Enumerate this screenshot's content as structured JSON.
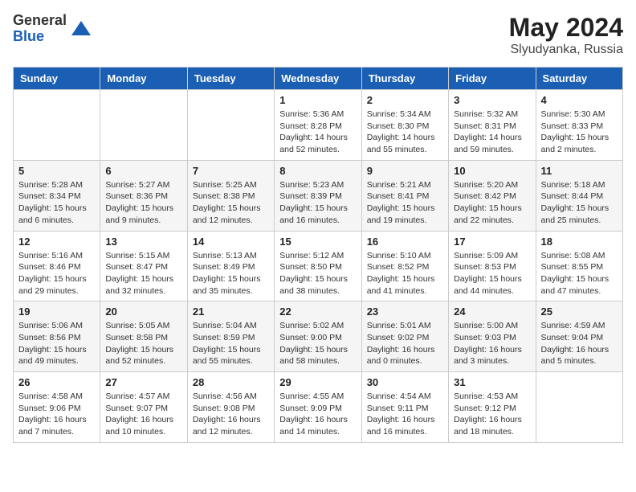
{
  "header": {
    "logo_general": "General",
    "logo_blue": "Blue",
    "month": "May 2024",
    "location": "Slyudyanka, Russia"
  },
  "weekdays": [
    "Sunday",
    "Monday",
    "Tuesday",
    "Wednesday",
    "Thursday",
    "Friday",
    "Saturday"
  ],
  "weeks": [
    [
      {
        "day": "",
        "info": ""
      },
      {
        "day": "",
        "info": ""
      },
      {
        "day": "",
        "info": ""
      },
      {
        "day": "1",
        "info": "Sunrise: 5:36 AM\nSunset: 8:28 PM\nDaylight: 14 hours\nand 52 minutes."
      },
      {
        "day": "2",
        "info": "Sunrise: 5:34 AM\nSunset: 8:30 PM\nDaylight: 14 hours\nand 55 minutes."
      },
      {
        "day": "3",
        "info": "Sunrise: 5:32 AM\nSunset: 8:31 PM\nDaylight: 14 hours\nand 59 minutes."
      },
      {
        "day": "4",
        "info": "Sunrise: 5:30 AM\nSunset: 8:33 PM\nDaylight: 15 hours\nand 2 minutes."
      }
    ],
    [
      {
        "day": "5",
        "info": "Sunrise: 5:28 AM\nSunset: 8:34 PM\nDaylight: 15 hours\nand 6 minutes."
      },
      {
        "day": "6",
        "info": "Sunrise: 5:27 AM\nSunset: 8:36 PM\nDaylight: 15 hours\nand 9 minutes."
      },
      {
        "day": "7",
        "info": "Sunrise: 5:25 AM\nSunset: 8:38 PM\nDaylight: 15 hours\nand 12 minutes."
      },
      {
        "day": "8",
        "info": "Sunrise: 5:23 AM\nSunset: 8:39 PM\nDaylight: 15 hours\nand 16 minutes."
      },
      {
        "day": "9",
        "info": "Sunrise: 5:21 AM\nSunset: 8:41 PM\nDaylight: 15 hours\nand 19 minutes."
      },
      {
        "day": "10",
        "info": "Sunrise: 5:20 AM\nSunset: 8:42 PM\nDaylight: 15 hours\nand 22 minutes."
      },
      {
        "day": "11",
        "info": "Sunrise: 5:18 AM\nSunset: 8:44 PM\nDaylight: 15 hours\nand 25 minutes."
      }
    ],
    [
      {
        "day": "12",
        "info": "Sunrise: 5:16 AM\nSunset: 8:46 PM\nDaylight: 15 hours\nand 29 minutes."
      },
      {
        "day": "13",
        "info": "Sunrise: 5:15 AM\nSunset: 8:47 PM\nDaylight: 15 hours\nand 32 minutes."
      },
      {
        "day": "14",
        "info": "Sunrise: 5:13 AM\nSunset: 8:49 PM\nDaylight: 15 hours\nand 35 minutes."
      },
      {
        "day": "15",
        "info": "Sunrise: 5:12 AM\nSunset: 8:50 PM\nDaylight: 15 hours\nand 38 minutes."
      },
      {
        "day": "16",
        "info": "Sunrise: 5:10 AM\nSunset: 8:52 PM\nDaylight: 15 hours\nand 41 minutes."
      },
      {
        "day": "17",
        "info": "Sunrise: 5:09 AM\nSunset: 8:53 PM\nDaylight: 15 hours\nand 44 minutes."
      },
      {
        "day": "18",
        "info": "Sunrise: 5:08 AM\nSunset: 8:55 PM\nDaylight: 15 hours\nand 47 minutes."
      }
    ],
    [
      {
        "day": "19",
        "info": "Sunrise: 5:06 AM\nSunset: 8:56 PM\nDaylight: 15 hours\nand 49 minutes."
      },
      {
        "day": "20",
        "info": "Sunrise: 5:05 AM\nSunset: 8:58 PM\nDaylight: 15 hours\nand 52 minutes."
      },
      {
        "day": "21",
        "info": "Sunrise: 5:04 AM\nSunset: 8:59 PM\nDaylight: 15 hours\nand 55 minutes."
      },
      {
        "day": "22",
        "info": "Sunrise: 5:02 AM\nSunset: 9:00 PM\nDaylight: 15 hours\nand 58 minutes."
      },
      {
        "day": "23",
        "info": "Sunrise: 5:01 AM\nSunset: 9:02 PM\nDaylight: 16 hours\nand 0 minutes."
      },
      {
        "day": "24",
        "info": "Sunrise: 5:00 AM\nSunset: 9:03 PM\nDaylight: 16 hours\nand 3 minutes."
      },
      {
        "day": "25",
        "info": "Sunrise: 4:59 AM\nSunset: 9:04 PM\nDaylight: 16 hours\nand 5 minutes."
      }
    ],
    [
      {
        "day": "26",
        "info": "Sunrise: 4:58 AM\nSunset: 9:06 PM\nDaylight: 16 hours\nand 7 minutes."
      },
      {
        "day": "27",
        "info": "Sunrise: 4:57 AM\nSunset: 9:07 PM\nDaylight: 16 hours\nand 10 minutes."
      },
      {
        "day": "28",
        "info": "Sunrise: 4:56 AM\nSunset: 9:08 PM\nDaylight: 16 hours\nand 12 minutes."
      },
      {
        "day": "29",
        "info": "Sunrise: 4:55 AM\nSunset: 9:09 PM\nDaylight: 16 hours\nand 14 minutes."
      },
      {
        "day": "30",
        "info": "Sunrise: 4:54 AM\nSunset: 9:11 PM\nDaylight: 16 hours\nand 16 minutes."
      },
      {
        "day": "31",
        "info": "Sunrise: 4:53 AM\nSunset: 9:12 PM\nDaylight: 16 hours\nand 18 minutes."
      },
      {
        "day": "",
        "info": ""
      }
    ]
  ]
}
